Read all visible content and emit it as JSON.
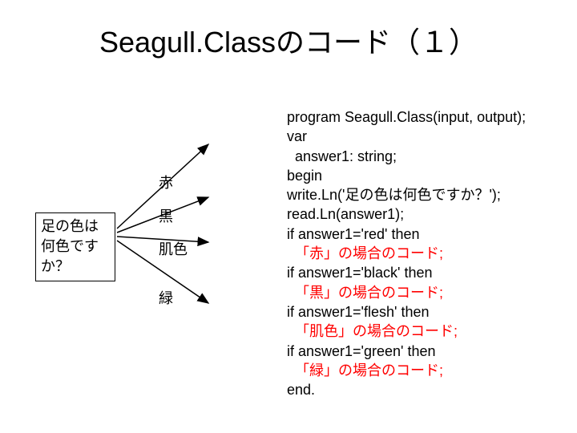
{
  "title": "Seagull.Classのコード（１）",
  "question": "足の色は何色ですか？",
  "labels": {
    "red": "赤",
    "black": "黒",
    "flesh": "肌色",
    "green": "緑"
  },
  "code": {
    "l1": "program Seagull.Class(input, output);",
    "l2": "var",
    "l3": "  answer1: string;",
    "l4": "begin",
    "l5": "write.Ln('足の色は何色ですか？');",
    "l6": "read.Ln(answer1);",
    "l7": "if answer1='red' then",
    "l8": "  「赤」の場合のコード;",
    "l9": "if answer1='black' then",
    "l10": "  「黒」の場合のコード;",
    "l11": "if answer1='flesh' then",
    "l12": "  「肌色」の場合のコード;",
    "l13": "if answer1='green' then",
    "l14": "  「緑」の場合のコード;",
    "l15": "end."
  }
}
